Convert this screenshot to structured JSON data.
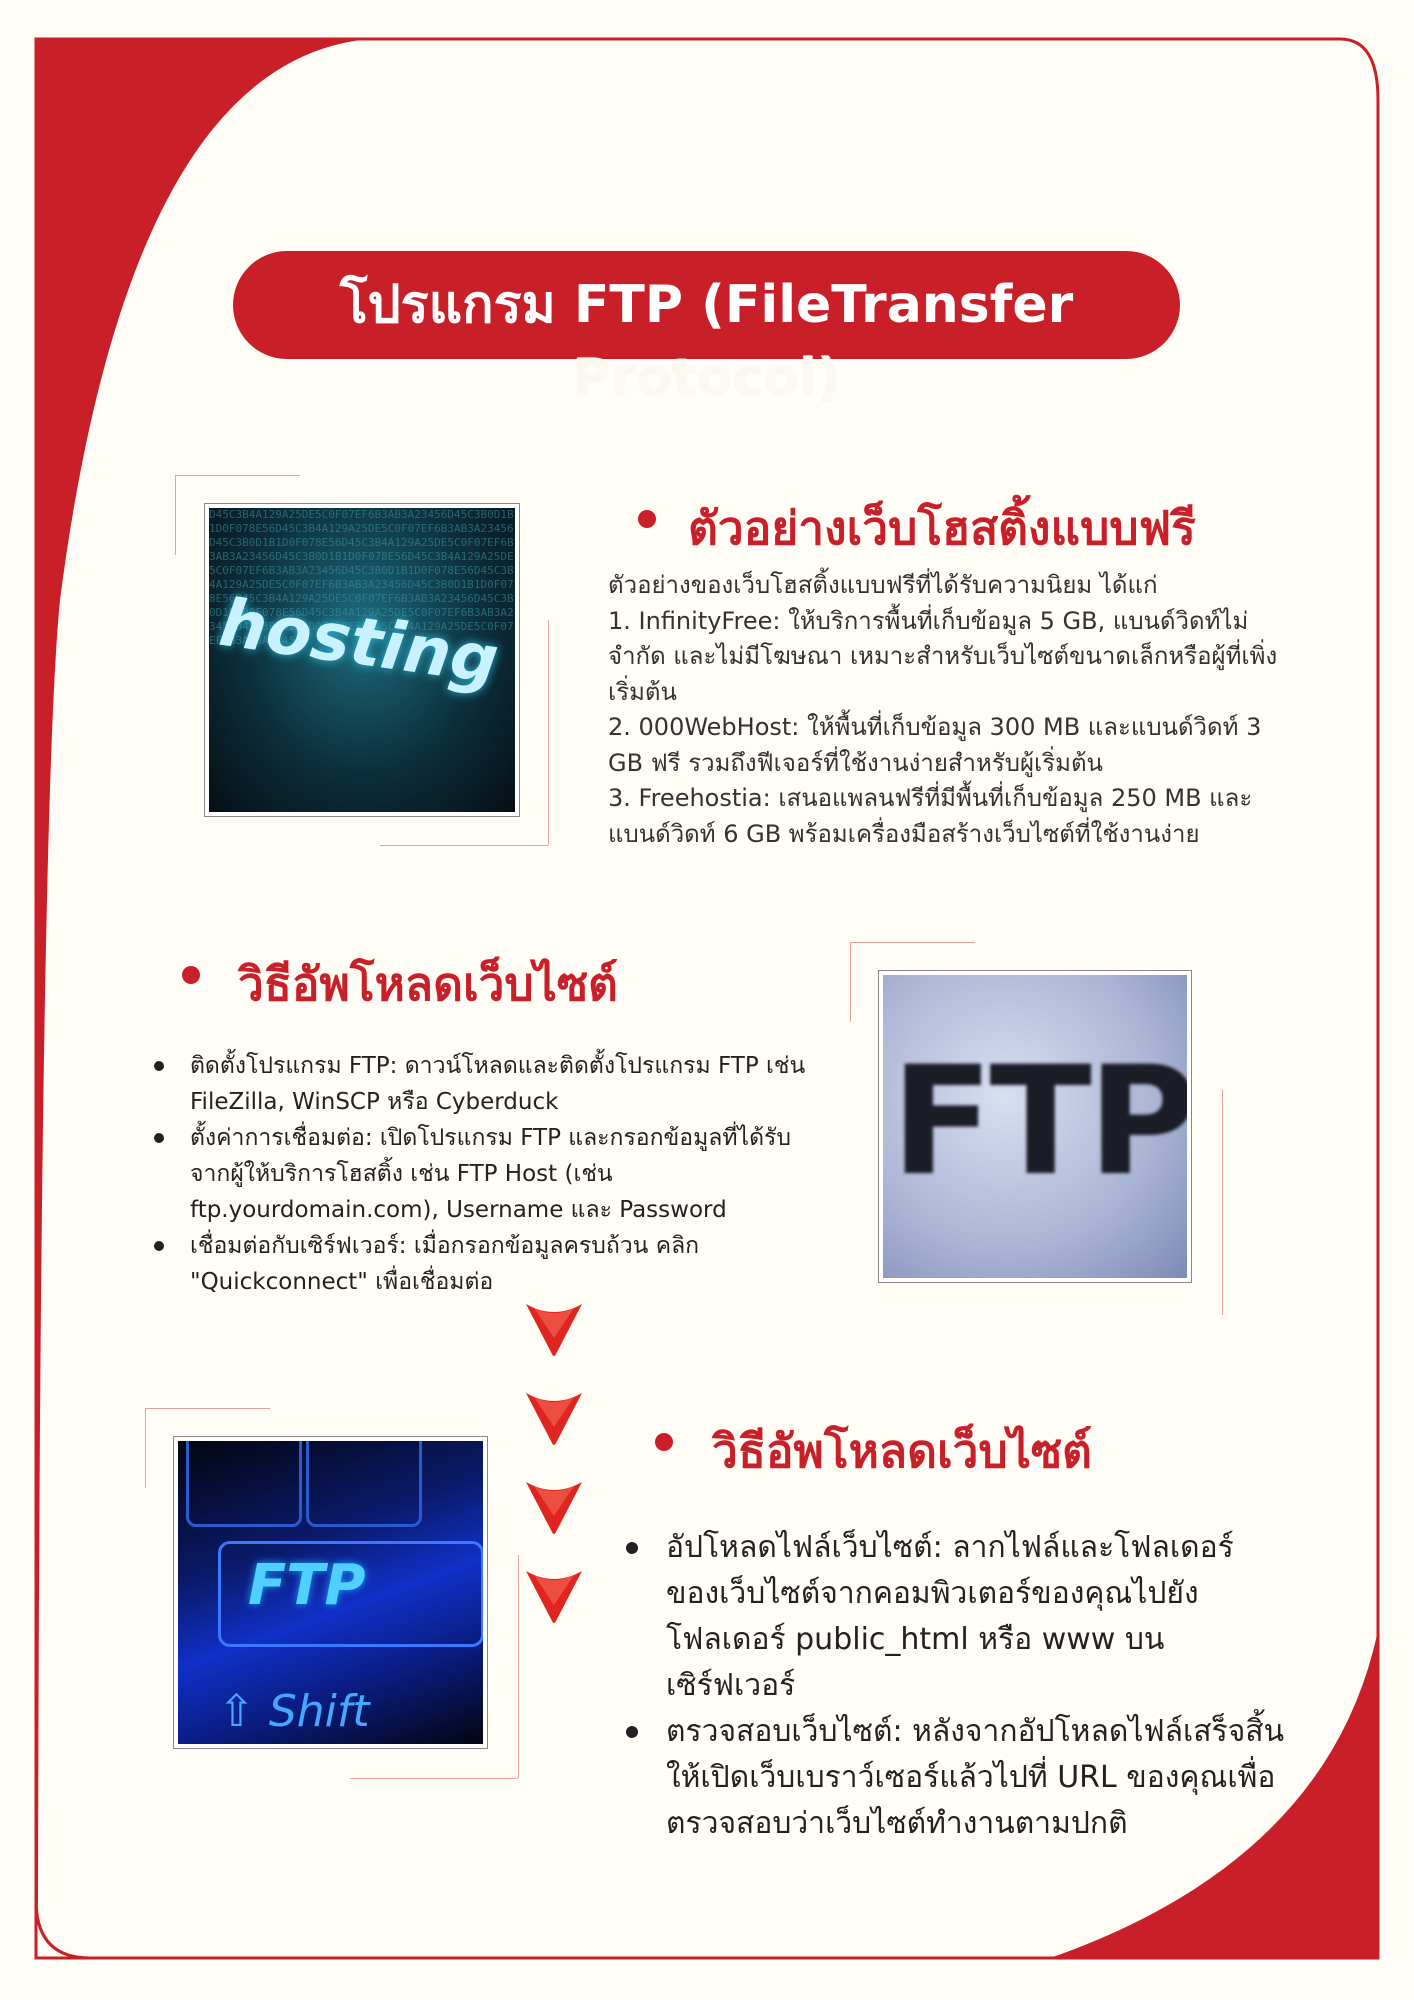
{
  "colors": {
    "accent": "#c91f28",
    "background": "#fffdf5"
  },
  "title": {
    "line1": "โปรแกรม FTP (FileTransfer",
    "line2": "Protocol)"
  },
  "section1": {
    "heading": "ตัวอย่างเว็บโฮสติ้งแบบฟรี",
    "image_text": "hosting",
    "paragraph": "ตัวอย่างของเว็บโฮสติ้งแบบฟรีที่ได้รับความนิยม ได้แก่\n1. InfinityFree: ให้บริการพื้นที่เก็บข้อมูล 5 GB, แบนด์วิดท์ไม่จำกัด และไม่มีโฆษณา เหมาะสำหรับเว็บไซต์ขนาดเล็กหรือผู้ที่เพิ่งเริ่มต้น\n2. 000WebHost: ให้พื้นที่เก็บข้อมูล 300 MB และแบนด์วิดท์ 3 GB ฟรี รวมถึงฟีเจอร์ที่ใช้งานง่ายสำหรับผู้เริ่มต้น\n3. Freehostia: เสนอแพลนฟรีที่มีพื้นที่เก็บข้อมูล 250 MB และแบนด์วิดท์ 6 GB พร้อมเครื่องมือสร้างเว็บไซต์ที่ใช้งานง่าย"
  },
  "section2": {
    "heading": "วิธีอัพโหลดเว็บไซต์",
    "image_text": "FTP",
    "items": [
      "ติดตั้งโปรแกรม FTP: ดาวน์โหลดและติดตั้งโปรแกรม FTP เช่น FileZilla, WinSCP หรือ Cyberduck",
      "ตั้งค่าการเชื่อมต่อ: เปิดโปรแกรม FTP และกรอกข้อมูลที่ได้รับจากผู้ให้บริการโฮสติ้ง เช่น FTP Host (เช่น ftp.yourdomain.com), Username และ Password",
      "เชื่อมต่อกับเซิร์ฟเวอร์: เมื่อกรอกข้อมูลครบถ้วน คลิก \"Quickconnect\" เพื่อเชื่อมต่อ"
    ]
  },
  "section3": {
    "heading": "วิธีอัพโหลดเว็บไซต์",
    "image_key_label": "FTP",
    "image_shift_label": "Shift",
    "items": [
      "อัปโหลดไฟล์เว็บไซต์: ลากไฟล์และโฟลเดอร์ของเว็บไซต์จากคอมพิวเตอร์ของคุณไปยังโฟลเดอร์ public_html หรือ www บนเซิร์ฟเวอร์",
      "ตรวจสอบเว็บไซต์: หลังจากอัปโหลดไฟล์เสร็จสิ้น ให้เปิดเว็บเบราว์เซอร์แล้วไปที่ URL ของคุณเพื่อตรวจสอบว่าเว็บไซต์ทำงานตามปกติ"
    ]
  },
  "icons": {
    "arrow": "chevron-down-icon",
    "bullet": "dot-icon"
  }
}
